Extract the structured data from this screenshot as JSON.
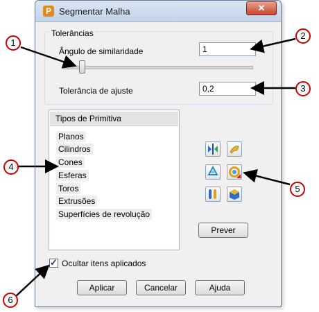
{
  "window": {
    "title": "Segmentar Malha",
    "app_icon_letter": "P",
    "close_glyph": "✕"
  },
  "tolerances": {
    "group_title": "Tolerâncias",
    "similarity_label": "Ângulo de similaridade",
    "similarity_value": "1",
    "slider_level_fraction": 0.1,
    "fit_label": "Tolerância de ajuste",
    "fit_value": "0,2"
  },
  "primitives": {
    "header": "Tipos de Primitiva",
    "items": [
      "Planos",
      "Cilindros",
      "Cones",
      "Esferas",
      "Toros",
      "Extrusões",
      "Superfícies de revolução"
    ]
  },
  "tools": {
    "icons": [
      "split-plane-icon",
      "cylinder-shape-icon",
      "recycle-icon",
      "target-ring-icon",
      "tool-pair-icon",
      "cube-shape-icon"
    ]
  },
  "buttons": {
    "preview": "Prever",
    "apply": "Aplicar",
    "cancel": "Cancelar",
    "help": "Ajuda"
  },
  "hide_applied": {
    "label": "Ocultar itens aplicados",
    "checked": true,
    "check_glyph": "✓"
  },
  "callouts": [
    "1",
    "2",
    "3",
    "4",
    "5",
    "6"
  ],
  "colors": {
    "callout_border": "#cc0000",
    "arrow": "#000000"
  }
}
